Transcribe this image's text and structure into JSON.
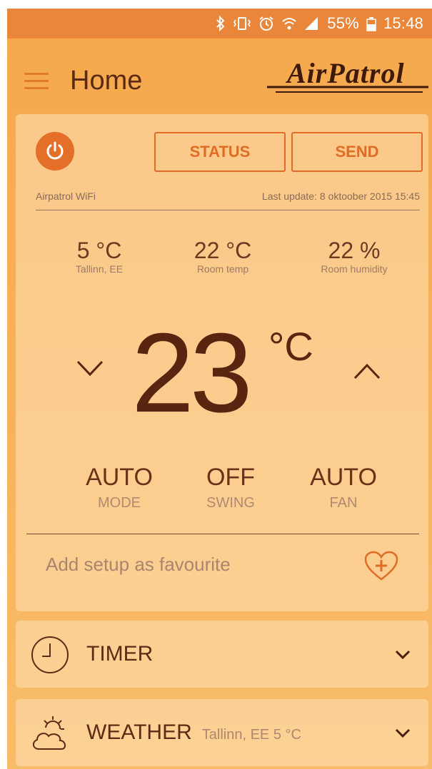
{
  "status_bar": {
    "icons": [
      "bluetooth-icon",
      "vibrate-icon",
      "alarm-icon",
      "wifi-icon",
      "signal-icon",
      "battery-icon"
    ],
    "battery_percent": "55%",
    "time": "15:48"
  },
  "app_bar": {
    "title": "Home",
    "logo_text": "AirPatrol",
    "menu_icon": "hamburger-menu-icon"
  },
  "control": {
    "power_icon": "power-icon",
    "status_label": "STATUS",
    "send_label": "SEND",
    "device_name": "Airpatrol WiFi",
    "last_update": "Last update: 8 oktoober 2015 15:45",
    "stats": [
      {
        "value": "5 °C",
        "label": "Tallinn, EE"
      },
      {
        "value": "22 °C",
        "label": "Room temp"
      },
      {
        "value": "22 %",
        "label": "Room humidity"
      }
    ],
    "set_temperature": "23",
    "temperature_unit": "°C",
    "modes": [
      {
        "value": "AUTO",
        "label": "MODE"
      },
      {
        "value": "OFF",
        "label": "SWING"
      },
      {
        "value": "AUTO",
        "label": "FAN"
      }
    ],
    "favourite_label": "Add setup as favourite",
    "favourite_icon": "heart-plus-icon"
  },
  "sections": [
    {
      "label": "TIMER",
      "sub": "",
      "icon": "clock-icon"
    },
    {
      "label": "WEATHER",
      "sub": "Tallinn, EE 5 °C",
      "icon": "weather-icon"
    }
  ],
  "colors": {
    "accent": "#e06c26",
    "status_bar": "#e9863a",
    "background": "#f7b25a",
    "text_dark": "#5a2510"
  }
}
